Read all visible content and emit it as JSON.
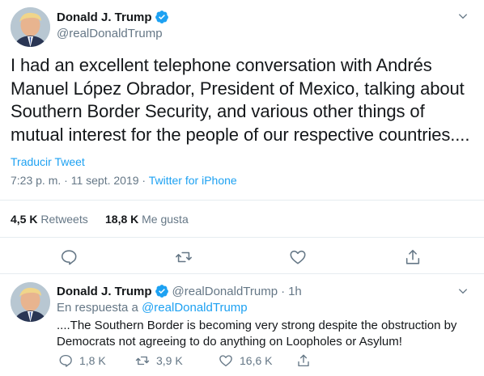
{
  "main_tweet": {
    "display_name": "Donald J. Trump",
    "handle": "@realDonaldTrump",
    "text": "I had an excellent telephone conversation with Andrés Manuel López Obrador, President of Mexico, talking about Southern Border Security, and various other things of mutual interest for the people of our respective countries....",
    "translate_label": "Traducir Tweet",
    "time": "7:23 p. m.",
    "date": "11 sept. 2019",
    "separator": "·",
    "source": "Twitter for iPhone",
    "retweets_count": "4,5 K",
    "retweets_label": "Retweets",
    "likes_count": "18,8 K",
    "likes_label": "Me gusta"
  },
  "reply_tweet": {
    "display_name": "Donald J. Trump",
    "handle": "@realDonaldTrump",
    "separator": "·",
    "time_ago": "1h",
    "reply_prefix": "En respuesta a",
    "reply_mention": "@realDonaldTrump",
    "text": "....The Southern Border is becoming very strong despite the obstruction by Democrats not agreeing to do anything on Loopholes or Asylum!",
    "replies": "1,8 K",
    "retweets": "3,9 K",
    "likes": "16,6 K"
  },
  "icons": {
    "verified": "verified-badge-icon",
    "caret": "chevron-down-icon",
    "reply": "reply-icon",
    "retweet": "retweet-icon",
    "like": "heart-icon",
    "share": "share-icon"
  },
  "colors": {
    "accent": "#1da1f2",
    "text": "#14171a",
    "secondary": "#657786",
    "border": "#e6ecf0"
  }
}
